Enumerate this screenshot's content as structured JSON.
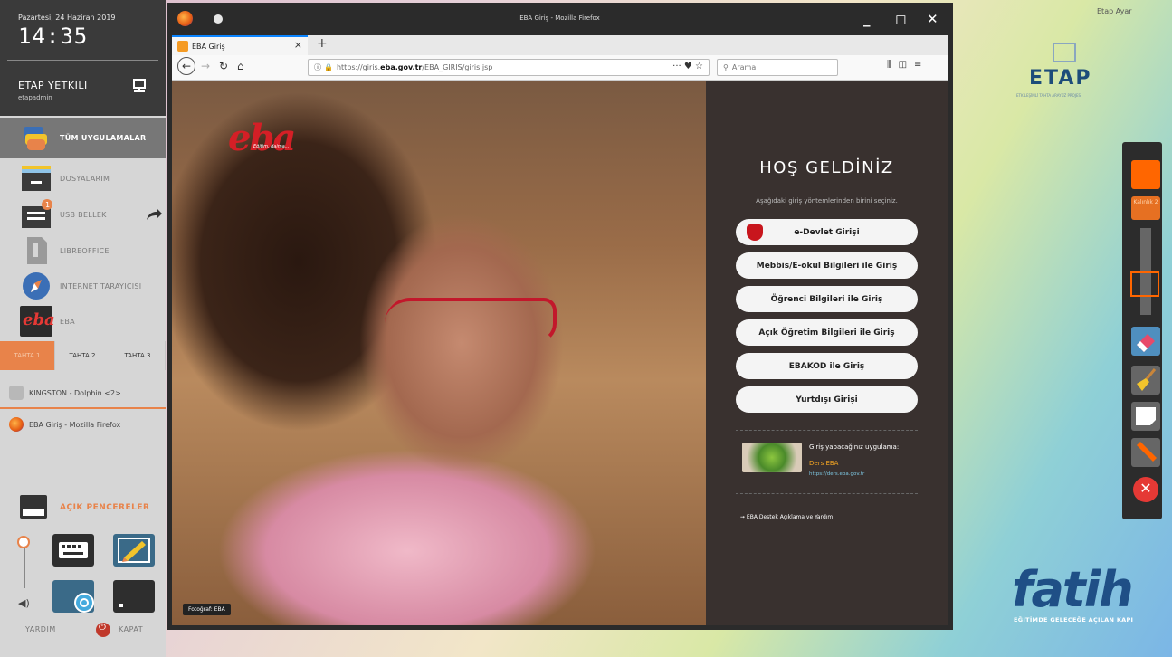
{
  "panel": {
    "date": "Pazartesi, 24 Haziran 2019",
    "time": "14:35",
    "user_name": "ETAP YETKILI",
    "user_login": "etapadmin",
    "apps": [
      {
        "label": "TÜM UYGULAMALAR",
        "icon": "all-apps-icon"
      },
      {
        "label": "DOSYALARIM",
        "icon": "folder-icon"
      },
      {
        "label": "USB BELLEK",
        "icon": "usb-drive-icon"
      },
      {
        "label": "LIBREOFFICE",
        "icon": "libreoffice-icon"
      },
      {
        "label": "INTERNET TARAYICISI",
        "icon": "browser-compass-icon"
      },
      {
        "label": "EBA",
        "icon": "eba-app-icon"
      }
    ],
    "usb_badge": "1",
    "tahta": [
      "TAHTA 1",
      "TAHTA 2",
      "TAHTA 3"
    ],
    "tasks": [
      {
        "label": "KINGSTON - Dolphin <2>",
        "icon": "file-manager-icon"
      },
      {
        "label": "EBA Giriş - Mozilla Firefox",
        "icon": "firefox-icon"
      }
    ],
    "open_windows_label": "AÇIK PENCERELER",
    "help_label": "YARDIM",
    "shutdown_label": "KAPAT"
  },
  "browser": {
    "window_title": "EBA Giriş - Mozilla Firefox",
    "tab_title": "EBA Giriş",
    "url_prefix": "https://giris.",
    "url_host": "eba.gov.tr",
    "url_path": "/EBA_GIRIS/giris.jsp",
    "search_placeholder": "Arama",
    "url_tools": "··· ♥ ☆"
  },
  "page": {
    "logo": "eba",
    "logo_tagline": "Eğitim, daima...",
    "photo_credit": "Fotoğraf: EBA",
    "welcome": "HOŞ GELDİNİZ",
    "instruction": "Aşağıdaki giriş yöntemlerinden birini seçiniz.",
    "buttons": [
      "e-Devlet Girişi",
      "Mebbis/E-okul Bilgileri ile Giriş",
      "Öğrenci Bilgileri ile Giriş",
      "Açık Öğretim Bilgileri ile Giriş",
      "EBAKOD ile Giriş",
      "Yurtdışı Girişi"
    ],
    "app_caption": "Giriş yapacağınız uygulama:",
    "app_name": "Ders EBA",
    "app_url": "https://ders.eba.gov.tr",
    "support": "➞ EBA Destek Açıklama ve Yardım"
  },
  "desktop": {
    "etap_user": "Etap Ayar",
    "etap_logo": "ETAP",
    "etap_sub": "ETKİLEŞİMLİ TAHTA ARAYÜZ PROJESİ",
    "size_label": "Kalınlık 2",
    "fatih_logo": "fatih",
    "fatih_sub": "EĞİTİMDE GELECEĞE AÇILAN KAPI",
    "accent_color": "#ff6600"
  }
}
